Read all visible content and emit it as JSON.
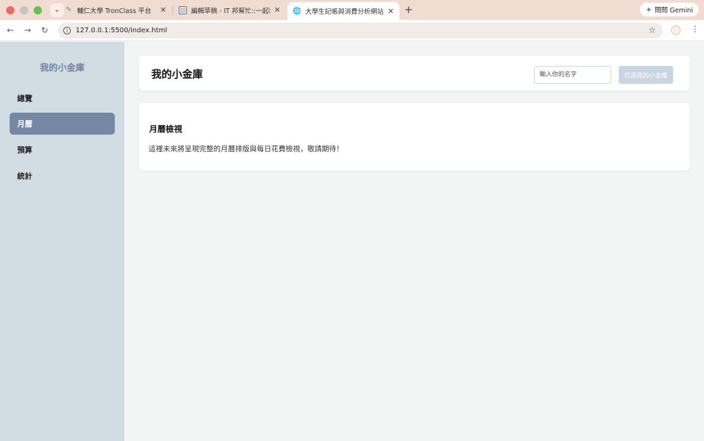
{
  "browser": {
    "tabs": [
      {
        "title": "輔仁大學 TronClass 平台",
        "favicon": "tronclass-icon"
      },
      {
        "title": "編輯草稿 - IT 邦幫忙::一起幫忙解",
        "favicon": "ithelp-icon"
      },
      {
        "title": "大學生記帳與消費分析網站",
        "favicon": "globe-icon"
      }
    ],
    "url": "127.0.0.1:5500/index.html",
    "gemini_label": "問問 Gemini"
  },
  "sidebar": {
    "brand": "我的小金庫",
    "items": [
      {
        "label": "總覽",
        "active": false
      },
      {
        "label": "月曆",
        "active": true
      },
      {
        "label": "預算",
        "active": false
      },
      {
        "label": "統計",
        "active": false
      }
    ]
  },
  "header": {
    "title": "我的小金庫",
    "name_placeholder": "輸入你的名字",
    "name_value": "",
    "create_label": "打造我的小金庫"
  },
  "main": {
    "section_title": "月曆檢視",
    "section_body": "這裡未來將呈現完整的月曆排版與每日花費檢視，敬請期待！"
  },
  "colors": {
    "sidebar_bg": "#d2dde3",
    "brand": "#6d84a2",
    "active_nav": "#7589a5",
    "button_disabled": "#c8d5e3",
    "page_bg": "#f3f5f4"
  }
}
